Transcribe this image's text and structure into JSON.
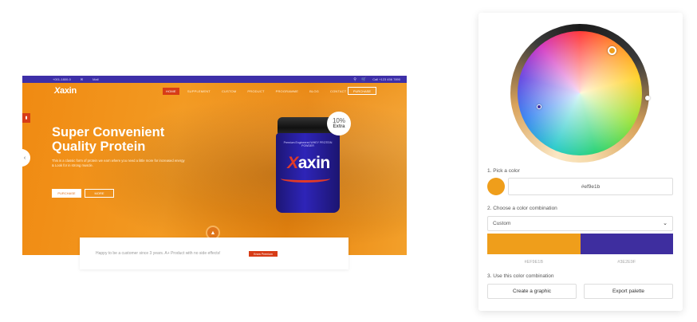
{
  "website": {
    "topbar": {
      "phone": "+001-1800-0",
      "mail": "✉",
      "contact_label": "Mail",
      "right_label": "Call +123 456 7890",
      "icons": [
        "search-icon",
        "cart-icon"
      ]
    },
    "logo": {
      "prefix": "",
      "text": "axin",
      "mark": "X"
    },
    "nav": [
      "HOME",
      "SUPPLEMENT",
      "CUSTOM",
      "PRODUCT",
      "PROGRAMME",
      "BLOG",
      "CONTACT"
    ],
    "nav_active_index": 0,
    "purchase_label": "PURCHASE",
    "side_tab_icon": "bookmark-icon",
    "prev_arrow": "‹",
    "hero": {
      "title_line1": "Super Convenient",
      "title_line2": "Quality Protein",
      "subtitle": "This is a classic form of protein we earn where you need a little more for increased energy & Look for in strong muscle.",
      "button_primary": "PURCHASE",
      "button_secondary": "MORE"
    },
    "jar": {
      "small_text": "Premium Engineered WHEY PROTEIN POWDER",
      "brand_mark": "X",
      "brand_text": "axin"
    },
    "badge": {
      "percent": "10%",
      "label": "Extra"
    },
    "scroll_icon": "▲",
    "info_strip": {
      "text": "Happy to be a customer since 3 years. A+ Product with no side effects!",
      "chip": "Know Premium"
    }
  },
  "color_tool": {
    "step1_label": "1. Pick a color",
    "picked_color": "#ef9e1b",
    "hex_value": "#ef9e1b",
    "step2_label": "2. Choose a color combination",
    "combination_selected": "Custom",
    "combo_colors": [
      "#ef9e1b",
      "#3e2e9f"
    ],
    "combo_labels": [
      "#EF9E1B",
      "#3E2E9F"
    ],
    "step3_label": "3. Use this color combination",
    "button_create": "Create a graphic",
    "button_export": "Export palette"
  }
}
